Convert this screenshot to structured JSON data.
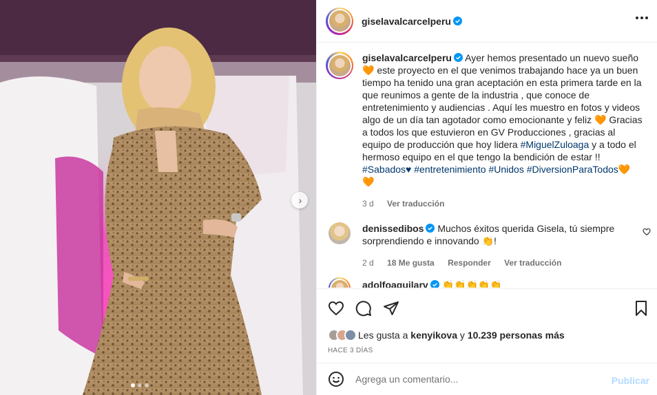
{
  "photo": {
    "alt": ""
  },
  "header": {
    "username": "giselavalcarcelperu"
  },
  "caption": {
    "username": "giselavalcarcelperu",
    "text_1": "Ayer hemos presentado un nuevo sueño",
    "text_2": "este proyecto en el que venimos trabajando hace ya un buen tiempo ha tenido una gran aceptación en esta primera tarde en la que reunimos a gente de la industria , que conoce de entretenimiento y audiencias . Aquí les muestro en fotos y videos algo de un día tan agotador como emocionante y feliz",
    "text_3": "Gracias a todos los que estuvieron en GV Producciones , gracias al equipo de producción que hoy lidera",
    "mention": "#MiguelZuloaga",
    "text_4": "y a todo el hermoso equipo en el que tengo la bendición de estar !!",
    "tags": [
      "#Sabados♥",
      "#entretenimiento",
      "#Unidos",
      "#DiversionParaTodos"
    ],
    "heart": "🧡",
    "time": "3 d",
    "translate": "Ver traducción"
  },
  "comment": {
    "username": "denissedibos",
    "text": "Muchos éxitos querida Gisela, tú siempre sorprendiendo e innovando 👏!",
    "time": "2 d",
    "likes": "18 Me gusta",
    "reply": "Responder",
    "translate": "Ver traducción"
  },
  "comment3": {
    "username": "adolfoaguilarv",
    "text": "👏👏👏👏👏"
  },
  "likes": {
    "prefix": "Les gusta a",
    "user": "kenyikova",
    "middle": "y",
    "count": "10.239 personas más"
  },
  "date": "HACE 3 DÍAS",
  "add_comment": {
    "placeholder": "Agrega un comentario...",
    "publish": "Publicar"
  },
  "colors": {
    "link": "#00376b",
    "muted": "#737373",
    "publish_disabled": "#b3dbff",
    "verified": "#0095f6"
  },
  "icons": [
    "like-icon",
    "comment-icon",
    "share-icon",
    "save-icon",
    "emoji-icon",
    "more-icon",
    "verified-icon",
    "next-icon"
  ]
}
